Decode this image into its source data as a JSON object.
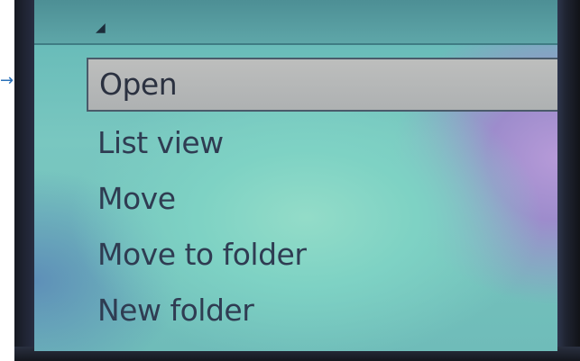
{
  "menu": {
    "items": [
      {
        "label": "Open",
        "selected": true
      },
      {
        "label": "List view",
        "selected": false
      },
      {
        "label": "Move",
        "selected": false
      },
      {
        "label": "Move to folder",
        "selected": false
      },
      {
        "label": "New folder",
        "selected": false
      }
    ]
  },
  "colors": {
    "screen_bg": "#79c7c0",
    "selection_bg": "#bdbebd",
    "text": "#2f3c52",
    "pointer": "#2a70b8"
  },
  "icons": {
    "pointer": "pointer-arrow-icon",
    "title_mark": "signal-icon"
  }
}
